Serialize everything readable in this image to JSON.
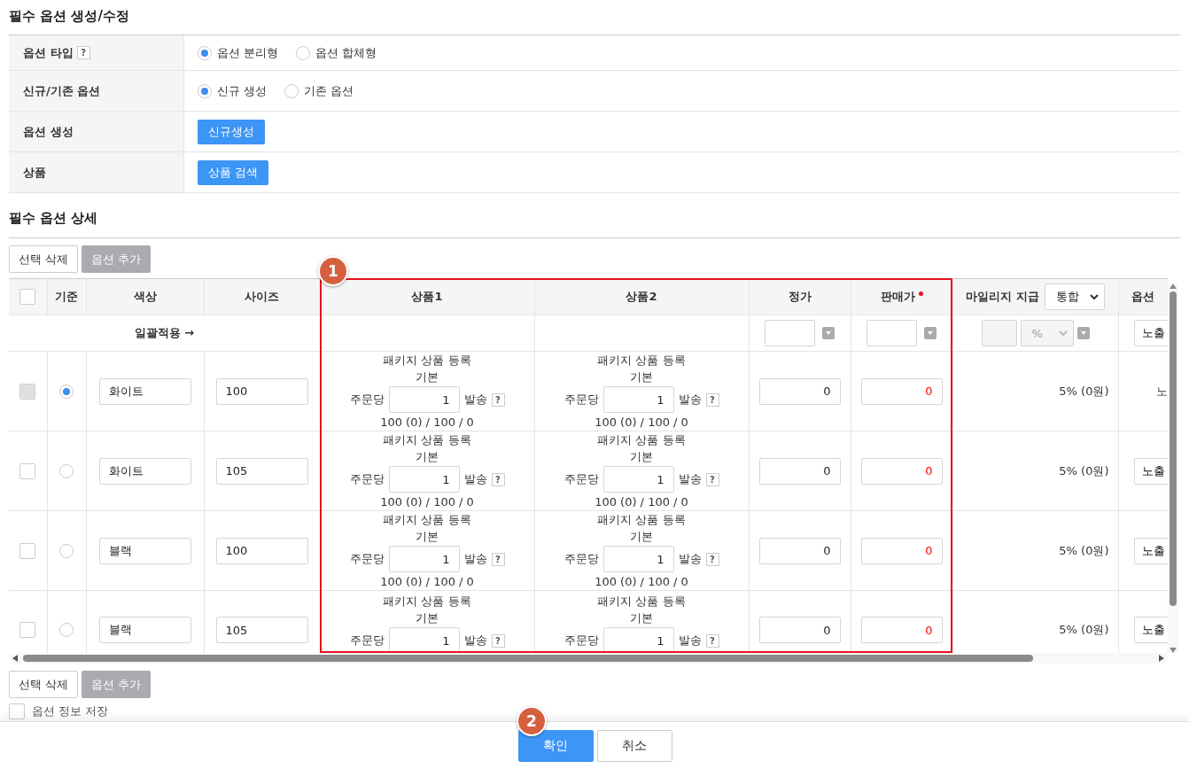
{
  "title": "필수 옵션 생성/수정",
  "form": {
    "rows": [
      {
        "kind": "radio",
        "label": "옵션 타입",
        "help": "?",
        "options": [
          {
            "label": "옵션 분리형",
            "selected": true
          },
          {
            "label": "옵션 합체형",
            "selected": false
          }
        ]
      },
      {
        "kind": "radio",
        "label": "신규/기존 옵션",
        "options": [
          {
            "label": "신규 생성",
            "selected": true
          },
          {
            "label": "기존 옵션",
            "selected": false
          }
        ]
      },
      {
        "kind": "button",
        "label": "옵션 생성",
        "button": "신규생성"
      },
      {
        "kind": "button",
        "label": "상품",
        "button": "상품 검색"
      }
    ]
  },
  "detail_title": "필수 옵션 상세",
  "toolbar_top": [
    {
      "label": "선택 삭제",
      "disabled": false
    },
    {
      "label": "옵션 추가",
      "disabled": true
    }
  ],
  "table": {
    "header_checkbox": {
      "checked": false
    },
    "columns": [
      {
        "label": "기준"
      },
      {
        "label": "색상"
      },
      {
        "label": "사이즈"
      },
      {
        "label": "상품1"
      },
      {
        "label": "상품2"
      },
      {
        "label": "정가"
      },
      {
        "label": "판매가",
        "required": true
      },
      {
        "label": "마일리지 지급",
        "select": "통합"
      },
      {
        "label": "옵션"
      }
    ],
    "bulk_row": {
      "label": "일괄적용 →",
      "mileage_unit": "%",
      "visibility": "노출"
    },
    "rows": [
      {
        "checked": false,
        "disabled": true,
        "selected": true,
        "variant": "화이트",
        "size": "100",
        "products": [
          {
            "title": "패키지 상품 등록",
            "type": "기본",
            "per_order": "주문당",
            "qty": "1",
            "ship": "발송",
            "help": "?",
            "stock": "100 (0) / 100 / 0"
          },
          {
            "title": "패키지 상품 등록",
            "type": "기본",
            "per_order": "주문당",
            "qty": "1",
            "ship": "발송",
            "help": "?",
            "stock": "100 (0) / 100 / 0"
          }
        ],
        "list_price": "0",
        "sale_price": "0",
        "mileage": "5% (0원)",
        "visibility": {
          "kind": "text",
          "label": "노"
        }
      },
      {
        "checked": false,
        "disabled": false,
        "selected": false,
        "variant": "화이트",
        "size": "105",
        "products": [
          {
            "title": "패키지 상품 등록",
            "type": "기본",
            "per_order": "주문당",
            "qty": "1",
            "ship": "발송",
            "help": "?",
            "stock": "100 (0) / 100 / 0"
          },
          {
            "title": "패키지 상품 등록",
            "type": "기본",
            "per_order": "주문당",
            "qty": "1",
            "ship": "발송",
            "help": "?",
            "stock": "100 (0) / 100 / 0"
          }
        ],
        "list_price": "0",
        "sale_price": "0",
        "mileage": "5% (0원)",
        "visibility": {
          "kind": "button",
          "label": "노출"
        }
      },
      {
        "checked": false,
        "disabled": false,
        "selected": false,
        "variant": "블랙",
        "size": "100",
        "products": [
          {
            "title": "패키지 상품 등록",
            "type": "기본",
            "per_order": "주문당",
            "qty": "1",
            "ship": "발송",
            "help": "?",
            "stock": "100 (0) / 100 / 0"
          },
          {
            "title": "패키지 상품 등록",
            "type": "기본",
            "per_order": "주문당",
            "qty": "1",
            "ship": "발송",
            "help": "?",
            "stock": "100 (0) / 100 / 0"
          }
        ],
        "list_price": "0",
        "sale_price": "0",
        "mileage": "5% (0원)",
        "visibility": {
          "kind": "button",
          "label": "노출"
        }
      },
      {
        "checked": false,
        "disabled": false,
        "selected": false,
        "variant": "블랙",
        "size": "105",
        "products": [
          {
            "title": "패키지 상품 등록",
            "type": "기본",
            "per_order": "주문당",
            "qty": "1",
            "ship": "발송",
            "help": "?"
          },
          {
            "title": "패키지 상품 등록",
            "type": "기본",
            "per_order": "주문당",
            "qty": "1",
            "ship": "발송",
            "help": "?"
          }
        ],
        "list_price": "0",
        "sale_price": "0",
        "mileage": "5% (0원)",
        "visibility": {
          "kind": "button",
          "label": "노출"
        }
      }
    ]
  },
  "annotations": [
    {
      "label": "1"
    },
    {
      "label": "2"
    }
  ],
  "toolbar_bottom": [
    {
      "label": "선택 삭제",
      "disabled": false
    },
    {
      "label": "옵션 추가",
      "disabled": true
    }
  ],
  "save_option": {
    "label": "옵션 정보 저장",
    "checked": false
  },
  "footer": {
    "buttons": [
      {
        "label": "확인",
        "primary": true
      },
      {
        "label": "취소",
        "primary": false
      }
    ]
  }
}
